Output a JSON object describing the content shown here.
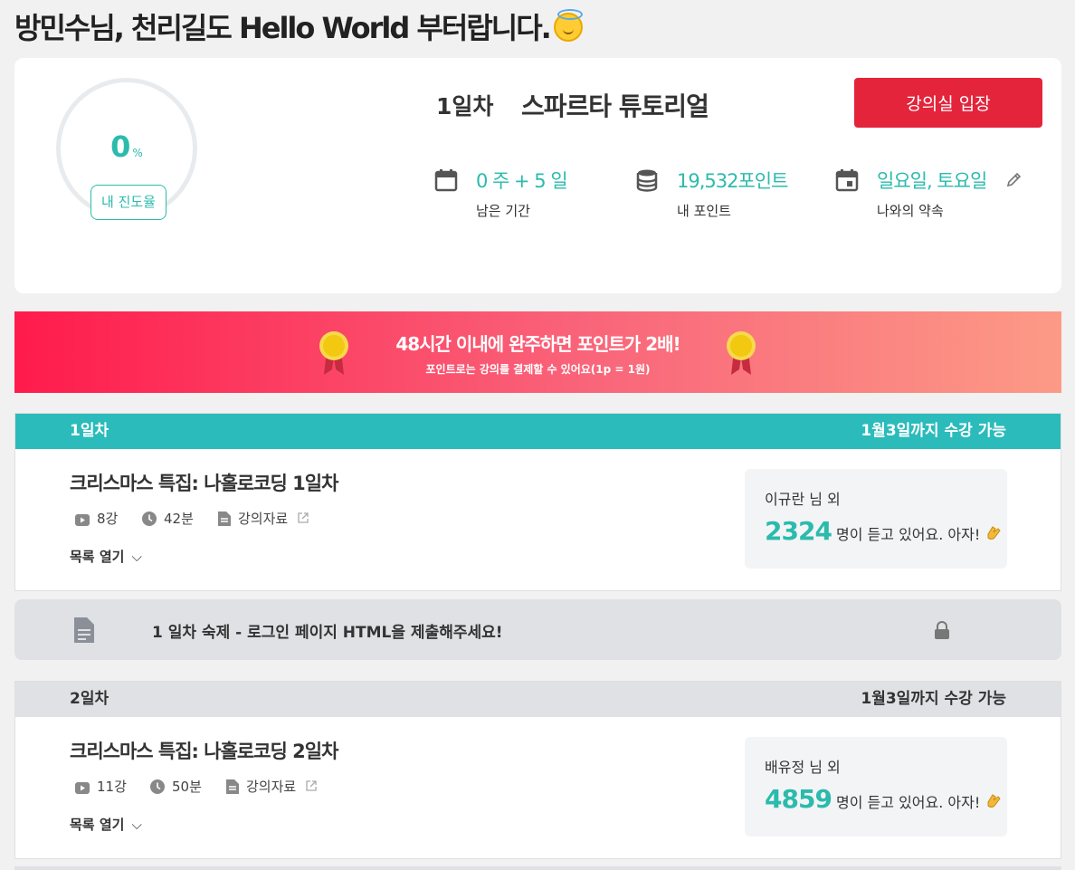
{
  "greeting": {
    "text": "방민수님, 천리길도 Hello World 부터랍니다."
  },
  "progress": {
    "percent": "0",
    "percent_unit": "%",
    "badge": "내 진도율",
    "value_fraction": 0
  },
  "course": {
    "day": "1일차",
    "title": "스파르타 튜토리얼",
    "enter_button": "강의실 입장"
  },
  "stats": [
    {
      "icon": "calendar-icon",
      "value": "0 주 + 5 일",
      "label": "남은 기간"
    },
    {
      "icon": "database-icon",
      "value": "19,532포인트",
      "label": "내 포인트"
    },
    {
      "icon": "calendar-event-icon",
      "value": "일요일, 토요일",
      "label": "나와의 약속"
    }
  ],
  "banner": {
    "title": "48시간 이내에 완주하면 포인트가 2배!",
    "subtitle": "포인트로는 강의를 결제할 수 있어요(1p = 1원)"
  },
  "weeks": [
    {
      "day": "1일차",
      "deadline": "1월3일까지 수강 가능",
      "lecture_title": "크리스마스 특집: 나홀로코딩 1일차",
      "lectures": "8강",
      "duration": "42분",
      "materials": "강의자료",
      "toggle": "목록 열기",
      "listener_name": "이규란 님 외",
      "listener_count": "2324",
      "listener_text": "명이 듣고 있어요. 아자!"
    },
    {
      "day": "2일차",
      "deadline": "1월3일까지 수강 가능",
      "lecture_title": "크리스마스 특집: 나홀로코딩 2일차",
      "lectures": "11강",
      "duration": "50분",
      "materials": "강의자료",
      "toggle": "목록 열기",
      "listener_name": "배유정 님 외",
      "listener_count": "4859",
      "listener_text": "명이 듣고 있어요. 아자!"
    }
  ],
  "homework": {
    "text": "1 일차 숙제 - 로그인 페이지 HTML을 제출해주세요!"
  },
  "colors": {
    "accent": "#2bbbad",
    "primary_button": "#e3243b",
    "week_active": "#2bbbbb",
    "week_inactive": "#dfe1e5"
  }
}
